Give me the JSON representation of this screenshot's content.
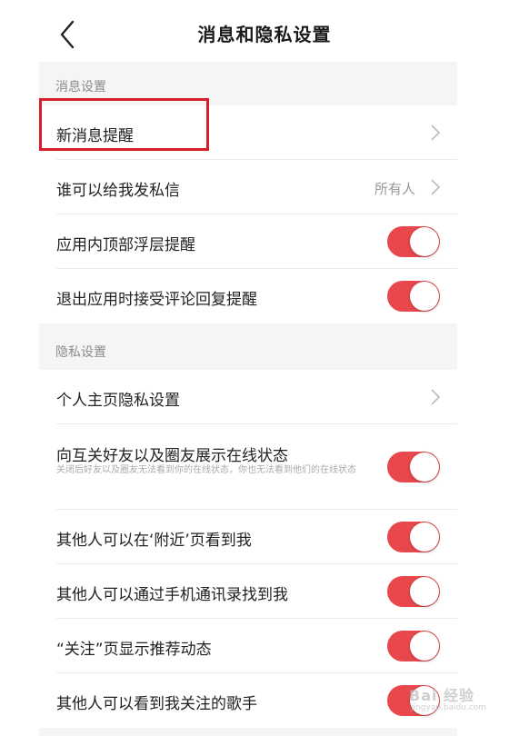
{
  "header": {
    "title": "消息和隐私设置"
  },
  "message_section": {
    "label": "消息设置"
  },
  "message_rows": [
    {
      "label": "新消息提醒"
    },
    {
      "label": "谁可以给我发私信",
      "value": "所有人"
    },
    {
      "label": "应用内顶部浮层提醒",
      "enabled": true
    },
    {
      "label": "退出应用时接受评论回复提醒",
      "enabled": true
    }
  ],
  "privacy_section": {
    "label": "隐私设置"
  },
  "privacy_rows": [
    {
      "label": "个人主页隐私设置"
    },
    {
      "label": "向互关好友以及圈友展示在线状态",
      "sub": "关闭后好友以及圈友无法看到你的在线状态，你也无法看到他们的在线状态",
      "enabled": true
    },
    {
      "label": "其他人可以在‘附近’页看到我",
      "enabled": true
    },
    {
      "label": "其他人可以通过手机通讯录找到我",
      "enabled": true
    },
    {
      "label": "“关注”页显示推荐动态",
      "enabled": true
    },
    {
      "label": "其他人可以看到我关注的歌手",
      "enabled": true
    }
  ],
  "watermark": {
    "text": "Bai 经验",
    "url": "jingyan.baidu.com"
  },
  "colors": {
    "accent": "#e8484b",
    "highlight": "#d5202a",
    "section_bg": "#f5f5f5"
  },
  "icons": {
    "back": "chevron-left-icon",
    "more": "chevron-right-icon"
  }
}
